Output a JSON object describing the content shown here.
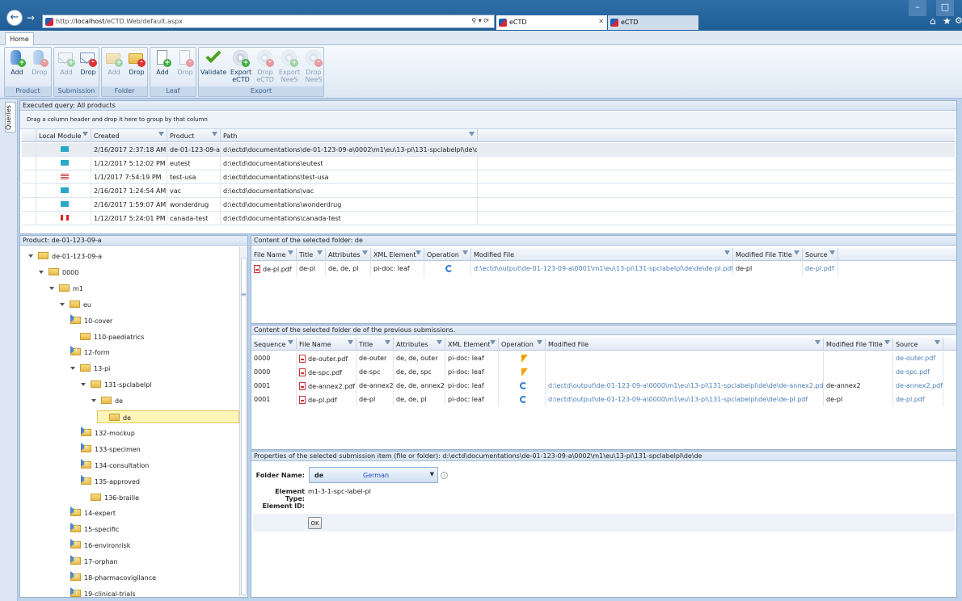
{
  "browser": {
    "url_prefix": "http://",
    "url_host": "localhost",
    "url_path": "/eCTD.Web/default.aspx",
    "tab_active": "eCTD",
    "tab_inactive": "eCTD"
  },
  "ribbon": {
    "home_tab": "Home",
    "groups": [
      {
        "caption": "Product",
        "buttons": [
          "Add",
          "Drop"
        ]
      },
      {
        "caption": "Submission",
        "buttons": [
          "Add",
          "Drop"
        ]
      },
      {
        "caption": "Folder",
        "buttons": [
          "Add",
          "Drop"
        ]
      },
      {
        "caption": "Leaf",
        "buttons": [
          "Add",
          "Drop"
        ]
      },
      {
        "caption": "Export",
        "buttons": [
          "Validate",
          "Export\neCTD",
          "Drop\neCTD",
          "Export\nNeeS",
          "Drop\nNeeS"
        ]
      }
    ]
  },
  "side": {
    "queries_tab": "Queries"
  },
  "query": {
    "title": "Executed query: All products",
    "group_hint": "Drag a column header and drop it here to group by that column",
    "columns": [
      "Local Module",
      "Created",
      "Product",
      "Path"
    ],
    "rows": [
      {
        "flag": "eu",
        "created": "2/16/2017 2:37:18 AM",
        "product": "de-01-123-09-a",
        "path": "d:\\ectd\\documentations\\de-01-123-09-a\\0002\\m1\\eu\\13-pi\\131-spclabelpl\\de\\de"
      },
      {
        "flag": "eu",
        "created": "1/12/2017 5:12:02 PM",
        "product": "eutest",
        "path": "d:\\ectd\\documentations\\eutest"
      },
      {
        "flag": "us",
        "created": "1/1/2017 7:54:19 PM",
        "product": "test-usa",
        "path": "d:\\ectd\\documentations\\test-usa"
      },
      {
        "flag": "eu",
        "created": "2/16/2017 1:24:54 AM",
        "product": "vac",
        "path": "d:\\ectd\\documentations\\vac"
      },
      {
        "flag": "eu",
        "created": "2/16/2017 1:59:07 AM",
        "product": "wonderdrug",
        "path": "d:\\ectd\\documentations\\wonderdrug"
      },
      {
        "flag": "ca",
        "created": "1/12/2017 5:24:01 PM",
        "product": "canada-test",
        "path": "d:\\ectd\\documentations\\canada-test"
      }
    ]
  },
  "tree": {
    "title": "Product: de-01-123-09-a",
    "nodes": [
      {
        "label": "de-01-123-09-a",
        "exp": "o"
      },
      {
        "label": "0000",
        "exp": "o"
      },
      {
        "label": "m1",
        "exp": "o"
      },
      {
        "label": "eu",
        "exp": "o"
      },
      {
        "label": "10-cover",
        "exp": "c"
      },
      {
        "label": "110-paediatrics",
        "exp": "n"
      },
      {
        "label": "12-form",
        "exp": "c"
      },
      {
        "label": "13-pi",
        "exp": "o"
      },
      {
        "label": "131-spclabelpl",
        "exp": "o"
      },
      {
        "label": "de",
        "exp": "o"
      },
      {
        "label": "de",
        "exp": "n",
        "selected": true
      },
      {
        "label": "132-mockup",
        "exp": "c"
      },
      {
        "label": "133-specimen",
        "exp": "c"
      },
      {
        "label": "134-consultation",
        "exp": "c"
      },
      {
        "label": "135-approved",
        "exp": "c"
      },
      {
        "label": "136-braille",
        "exp": "n"
      },
      {
        "label": "14-expert",
        "exp": "c"
      },
      {
        "label": "15-specific",
        "exp": "c"
      },
      {
        "label": "16-environrisk",
        "exp": "c"
      },
      {
        "label": "17-orphan",
        "exp": "c"
      },
      {
        "label": "18-pharmacovigilance",
        "exp": "c"
      },
      {
        "label": "19-clinical-trials",
        "exp": "c"
      }
    ]
  },
  "content": {
    "title": "Content of the selected folder: de",
    "columns": [
      "File Name",
      "Title",
      "Attributes",
      "XML Element",
      "Operation",
      "Modified File",
      "Modified File Title",
      "Source"
    ],
    "rows": [
      {
        "file": "de-pl.pdf",
        "title": "de-pl",
        "attrs": "de, de, pl",
        "xml": "pi-doc: leaf",
        "op": "replace",
        "modified": "d:\\ectd\\output\\de-01-123-09-a\\0001\\m1\\eu\\13-pi\\131-spclabelpl\\de\\de\\de-pl.pdf",
        "mtitle": "de-pl",
        "source": "de-pl.pdf"
      }
    ]
  },
  "previous": {
    "title": "Content of the selected folder de of the previous submissions.",
    "columns": [
      "Sequence",
      "File Name",
      "Title",
      "Attributes",
      "XML Element",
      "Operation",
      "Modified File",
      "Modified File Title",
      "Source"
    ],
    "rows": [
      {
        "seq": "0000",
        "file": "de-outer.pdf",
        "title": "de-outer",
        "attrs": "de, de, outer",
        "xml": "pi-doc: leaf",
        "op": "new",
        "modified": "",
        "mtitle": "",
        "source": "de-outer.pdf"
      },
      {
        "seq": "0000",
        "file": "de-spc.pdf",
        "title": "de-spc",
        "attrs": "de, de, spc",
        "xml": "pi-doc: leaf",
        "op": "new",
        "modified": "",
        "mtitle": "",
        "source": "de-spc.pdf"
      },
      {
        "seq": "0001",
        "file": "de-annex2.pdf",
        "title": "de-annex2",
        "attrs": "de, de, annex2",
        "xml": "pi-doc: leaf",
        "op": "replace",
        "modified": "d:\\ectd\\output\\de-01-123-09-a\\0000\\m1\\eu\\13-pi\\131-spclabelpl\\de\\de\\de-annex2.pdf",
        "mtitle": "de-annex2",
        "source": "de-annex2.pdf"
      },
      {
        "seq": "0001",
        "file": "de-pl.pdf",
        "title": "de-pl",
        "attrs": "de, de, pl",
        "xml": "pi-doc: leaf",
        "op": "replace",
        "modified": "d:\\ectd\\output\\de-01-123-09-a\\0000\\m1\\eu\\13-pi\\131-spclabelpl\\de\\de\\de-pl.pdf",
        "mtitle": "de-pl",
        "source": "de-pl.pdf"
      }
    ]
  },
  "props": {
    "title": "Properties of the selected submission item (file or folder): d:\\ectd\\documentations\\de-01-123-09-a\\0002\\m1\\eu\\13-pi\\131-spclabelpl\\de\\de",
    "folder_name_label": "Folder Name:",
    "folder_code": "de",
    "folder_lang": "German",
    "element_type_label": "Element Type:",
    "element_type": "m1-3-1-spc-label-pl",
    "element_id_label": "Element ID:",
    "ok": "OK"
  },
  "colors": {
    "accent": "#1f5d96",
    "link": "#4a7fb8",
    "header_bg": "#d6e3f2"
  }
}
